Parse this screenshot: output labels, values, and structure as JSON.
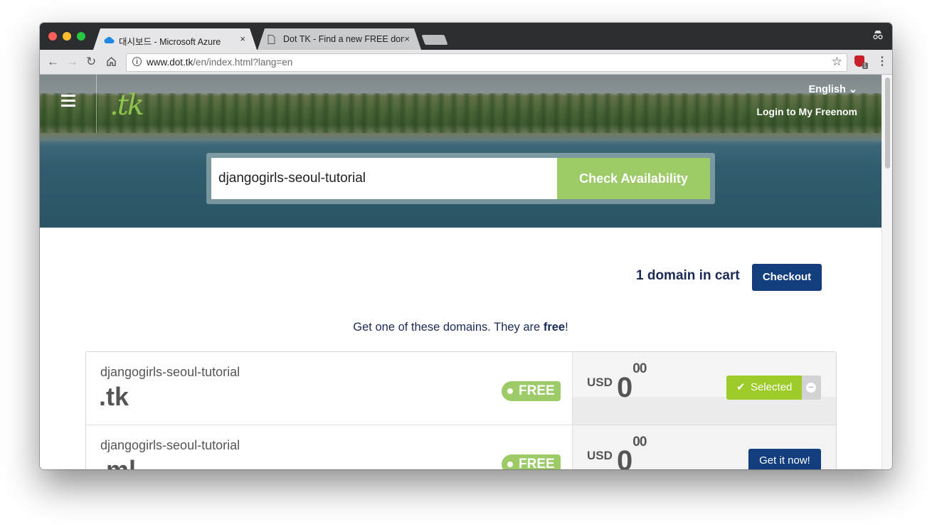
{
  "tabs": [
    {
      "title": "대시보드 - Microsoft Azure",
      "close": "×"
    },
    {
      "title": "Dot TK - Find a new FREE domain",
      "close": "×"
    }
  ],
  "toolbar": {
    "url_host": "www.dot.tk",
    "url_path": "/en/index.html?lang=en",
    "extension_badge": "1"
  },
  "header": {
    "logo": ".tk",
    "language": "English ⌄",
    "login": "Login to My Freenom"
  },
  "search": {
    "value": "djangogirls-seoul-tutorial",
    "button": "Check Availability"
  },
  "cart": {
    "summary": "1 domain in cart",
    "checkout": "Checkout"
  },
  "tagline": {
    "before": "Get one of these domains. They are ",
    "bold": "free",
    "after": "!"
  },
  "results": [
    {
      "name": "djangogirls-seoul-tutorial",
      "tld": ".tk",
      "badge": "FREE",
      "currency": "USD",
      "price_int": "0",
      "price_dec": "00",
      "action": "Selected",
      "status": "selected"
    },
    {
      "name": "djangogirls-seoul-tutorial",
      "tld": ".ml",
      "badge": "FREE",
      "currency": "USD",
      "price_int": "0",
      "price_dec": "00",
      "action": "Get it now!",
      "status": "available"
    }
  ],
  "colors": {
    "accent_green": "#9ccb68",
    "navy": "#123e7d",
    "selected_green": "#9ccb2a"
  }
}
